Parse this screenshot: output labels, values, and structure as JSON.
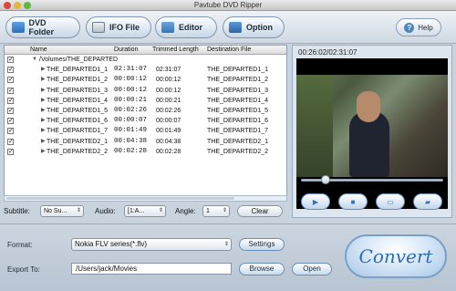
{
  "window": {
    "title": "Pavtube DVD Ripper"
  },
  "toolbar": {
    "dvd_folder": "DVD Folder",
    "ifo_file": "IFO File",
    "editor": "Editor",
    "option": "Option",
    "help": "Help"
  },
  "file_list": {
    "headers": {
      "name": "Name",
      "duration": "Duration",
      "trimmed": "Trimmed Length",
      "destination": "Destination File"
    },
    "root": "/Volumes/THE_DEPARTED",
    "rows": [
      {
        "name": "THE_DEPARTED1_1",
        "duration": "02:31:07",
        "trimmed": "02:31:07",
        "dest": "THE_DEPARTED1_1"
      },
      {
        "name": "THE_DEPARTED1_2",
        "duration": "00:00:12",
        "trimmed": "00:00:12",
        "dest": "THE_DEPARTED1_2"
      },
      {
        "name": "THE_DEPARTED1_3",
        "duration": "00:00:12",
        "trimmed": "00:00:12",
        "dest": "THE_DEPARTED1_3"
      },
      {
        "name": "THE_DEPARTED1_4",
        "duration": "00:00:21",
        "trimmed": "00:00:21",
        "dest": "THE_DEPARTED1_4"
      },
      {
        "name": "THE_DEPARTED1_5",
        "duration": "00:02:26",
        "trimmed": "00:02:26",
        "dest": "THE_DEPARTED1_5"
      },
      {
        "name": "THE_DEPARTED1_6",
        "duration": "00:00:07",
        "trimmed": "00:00:07",
        "dest": "THE_DEPARTED1_6"
      },
      {
        "name": "THE_DEPARTED1_7",
        "duration": "00:01:49",
        "trimmed": "00:01:49",
        "dest": "THE_DEPARTED1_7"
      },
      {
        "name": "THE_DEPARTED2_1",
        "duration": "00:04:38",
        "trimmed": "00:04:38",
        "dest": "THE_DEPARTED2_1"
      },
      {
        "name": "THE_DEPARTED2_2",
        "duration": "00:02:28",
        "trimmed": "00:02:28",
        "dest": "THE_DEPARTED2_2"
      }
    ]
  },
  "controls": {
    "subtitle_label": "Subtitle:",
    "subtitle_value": "No Su...",
    "audio_label": "Audio:",
    "audio_value": "[1:A...",
    "angle_label": "Angle:",
    "angle_value": "1",
    "clear": "Clear"
  },
  "preview": {
    "time": "00:26:02/02:31:07",
    "seek_progress": 0.17
  },
  "output": {
    "format_label": "Format:",
    "format_value": "Nokia FLV series(*.flv)",
    "settings": "Settings",
    "export_label": "Export To:",
    "export_path": "/Users/jack/Movies",
    "browse": "Browse",
    "open": "Open",
    "convert": "Convert"
  },
  "colors": {
    "accent": "#2f6db3",
    "panel": "#dde5ee"
  }
}
